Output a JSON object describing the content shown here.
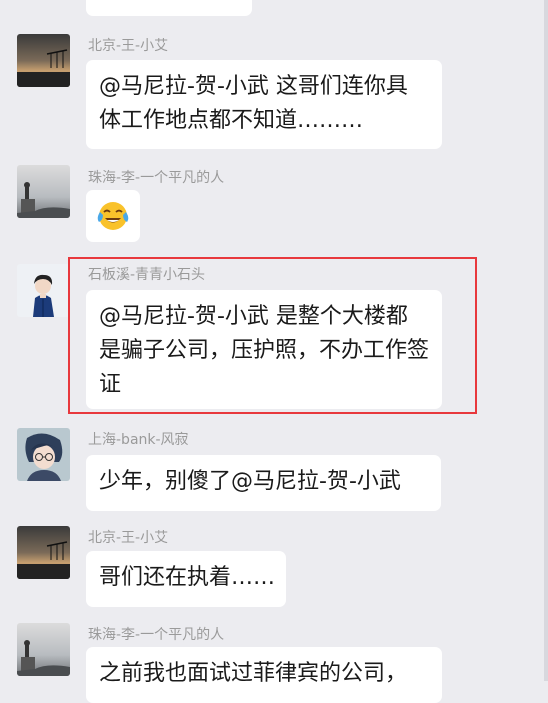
{
  "messages": [
    {
      "sender": "北京-王-小艾",
      "lines": [
        "@马尼拉-贺-小武  这哥们连你具",
        "体工作地点都不知道………"
      ]
    },
    {
      "sender": "珠海-李-一个平凡的人",
      "emoji": "crying-laughing-emoji"
    },
    {
      "sender": "石板溪-青青小石头",
      "lines": [
        "@马尼拉-贺-小武  是整个大楼都",
        "是骗子公司，压护照，不办工作签",
        "证"
      ]
    },
    {
      "sender": "上海-bank-风寂",
      "lines": [
        "少年，别傻了@马尼拉-贺-小武"
      ]
    },
    {
      "sender": "北京-王-小艾",
      "lines": [
        "哥们还在执着……"
      ]
    },
    {
      "sender": "珠海-李-一个平凡的人",
      "lines": [
        "之前我也面试过菲律宾的公司，"
      ]
    }
  ],
  "colors": {
    "background": "#ececf0",
    "bubble": "#ffffff",
    "sender_text": "#9a9a9a",
    "highlight": "#e8383d"
  }
}
